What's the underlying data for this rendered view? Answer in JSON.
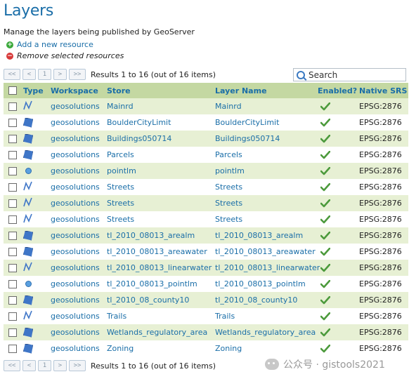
{
  "page": {
    "title": "Layers",
    "description": "Manage the layers being published by GeoServer",
    "add_label": "Add a new resource",
    "remove_label": "Remove selected resources"
  },
  "pager": {
    "first": "<<",
    "prev": "<",
    "page": "1",
    "next": ">",
    "last": ">>",
    "results": "Results 1 to 16 (out of 16 items)"
  },
  "search": {
    "placeholder": "Search"
  },
  "columns": {
    "type": "Type",
    "workspace": "Workspace",
    "store": "Store",
    "layer_name": "Layer Name",
    "enabled": "Enabled?",
    "native_srs": "Native SRS"
  },
  "rows": [
    {
      "type": "line",
      "workspace": "geosolutions",
      "store": "Mainrd",
      "layer": "Mainrd",
      "srs": "EPSG:2876"
    },
    {
      "type": "polygon",
      "workspace": "geosolutions",
      "store": "BoulderCityLimit",
      "layer": "BoulderCityLimit",
      "srs": "EPSG:2876"
    },
    {
      "type": "polygon",
      "workspace": "geosolutions",
      "store": "Buildings050714",
      "layer": "Buildings050714",
      "srs": "EPSG:2876"
    },
    {
      "type": "polygon",
      "workspace": "geosolutions",
      "store": "Parcels",
      "layer": "Parcels",
      "srs": "EPSG:2876"
    },
    {
      "type": "point",
      "workspace": "geosolutions",
      "store": "pointlm",
      "layer": "pointlm",
      "srs": "EPSG:2876"
    },
    {
      "type": "line",
      "workspace": "geosolutions",
      "store": "Streets",
      "layer": "Streets",
      "srs": "EPSG:2876"
    },
    {
      "type": "line",
      "workspace": "geosolutions",
      "store": "Streets",
      "layer": "Streets",
      "srs": "EPSG:2876"
    },
    {
      "type": "line",
      "workspace": "geosolutions",
      "store": "Streets",
      "layer": "Streets",
      "srs": "EPSG:2876"
    },
    {
      "type": "polygon",
      "workspace": "geosolutions",
      "store": "tl_2010_08013_arealm",
      "layer": "tl_2010_08013_arealm",
      "srs": "EPSG:2876"
    },
    {
      "type": "polygon",
      "workspace": "geosolutions",
      "store": "tl_2010_08013_areawater",
      "layer": "tl_2010_08013_areawater",
      "srs": "EPSG:2876"
    },
    {
      "type": "line",
      "workspace": "geosolutions",
      "store": "tl_2010_08013_linearwater",
      "layer": "tl_2010_08013_linearwater",
      "srs": "EPSG:2876"
    },
    {
      "type": "point",
      "workspace": "geosolutions",
      "store": "tl_2010_08013_pointlm",
      "layer": "tl_2010_08013_pointlm",
      "srs": "EPSG:2876"
    },
    {
      "type": "polygon",
      "workspace": "geosolutions",
      "store": "tl_2010_08_county10",
      "layer": "tl_2010_08_county10",
      "srs": "EPSG:2876"
    },
    {
      "type": "line",
      "workspace": "geosolutions",
      "store": "Trails",
      "layer": "Trails",
      "srs": "EPSG:2876"
    },
    {
      "type": "polygon",
      "workspace": "geosolutions",
      "store": "Wetlands_regulatory_area",
      "layer": "Wetlands_regulatory_area",
      "srs": "EPSG:2876"
    },
    {
      "type": "polygon",
      "workspace": "geosolutions",
      "store": "Zoning",
      "layer": "Zoning",
      "srs": "EPSG:2876"
    }
  ],
  "watermark": "公众号 · gistools2021",
  "colors": {
    "link": "#1a6ea8",
    "header_bg": "#c4d8a2",
    "alt_row": "#e7f0d4",
    "enabled_check": "#4c9a3c"
  }
}
